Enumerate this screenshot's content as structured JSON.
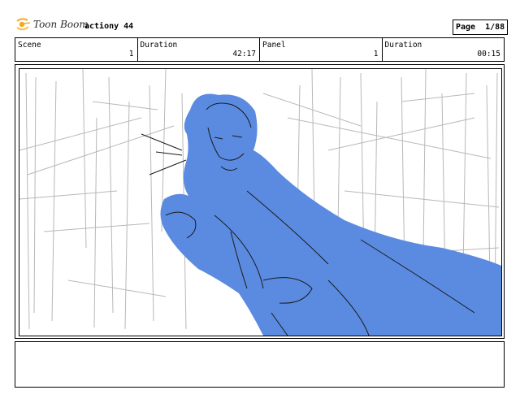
{
  "header": {
    "logo_text": "Toon Boom",
    "project_name": "actiony 44",
    "page": {
      "label": "Page",
      "current": "1",
      "total": "88",
      "display": "Page  1/88"
    }
  },
  "info": {
    "scene_label": "Scene",
    "scene_value": "1",
    "duration1_label": "Duration",
    "duration1_value": "42:17",
    "panel_label": "Panel",
    "panel_value": "1",
    "duration2_label": "Duration",
    "duration2_value": "00:15"
  },
  "panel": {
    "character_color": "#5b8be0",
    "line_color": "#1a1a1a"
  },
  "notes": {
    "text": ""
  }
}
